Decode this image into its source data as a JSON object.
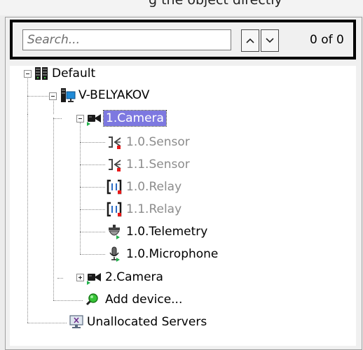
{
  "window": {
    "title_fragment": "g the object directly"
  },
  "search": {
    "placeholder": "Search...",
    "value": "",
    "counter": "0 of 0"
  },
  "tree": {
    "root": {
      "label": "Default",
      "icon": "server-rack-icon"
    },
    "computer": {
      "label": "V-BELYAKOV",
      "icon": "computer-icon"
    },
    "camera1": {
      "label": "1.Camera",
      "icon": "camera-icon",
      "selected": true
    },
    "camera1_children": [
      {
        "label": "1.0.Sensor",
        "icon": "sensor-icon",
        "disabled": true,
        "status": "red"
      },
      {
        "label": "1.1.Sensor",
        "icon": "sensor-icon",
        "disabled": true,
        "status": "red"
      },
      {
        "label": "1.0.Relay",
        "icon": "relay-icon",
        "disabled": true,
        "status": "red"
      },
      {
        "label": "1.1.Relay",
        "icon": "relay-icon",
        "disabled": true,
        "status": "red"
      },
      {
        "label": "1.0.Telemetry",
        "icon": "ptz-dome-icon",
        "disabled": false,
        "status": "green"
      },
      {
        "label": "1.0.Microphone",
        "icon": "microphone-icon",
        "disabled": false,
        "status": "green"
      }
    ],
    "camera2": {
      "label": "2.Camera",
      "icon": "camera-icon"
    },
    "add_device": {
      "label": "Add device...",
      "icon": "magnifier-icon"
    },
    "unallocated": {
      "label": "Unallocated Servers",
      "icon": "monitor-x-icon"
    }
  },
  "colors": {
    "selection": "#7d78e0",
    "status_green": "#22b14c",
    "status_red": "#e81818",
    "disabled_text": "#8c8c8c"
  }
}
